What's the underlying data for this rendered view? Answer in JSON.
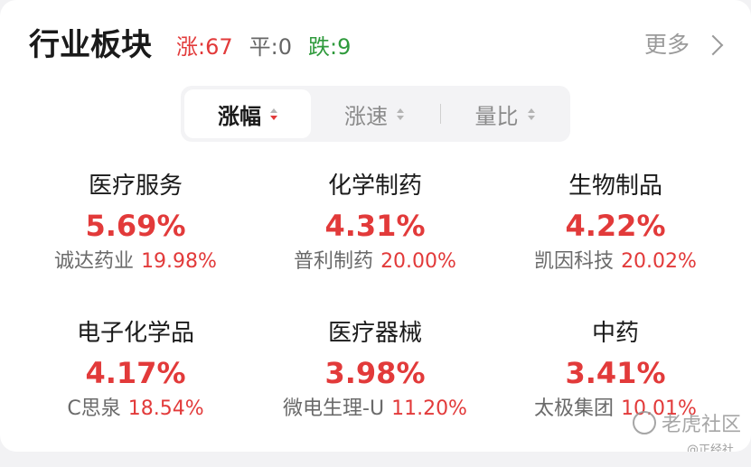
{
  "header": {
    "title": "行业板块",
    "stats": {
      "up": "涨:67",
      "flat": "平:0",
      "down": "跌:9"
    },
    "more_label": "更多"
  },
  "tabs": [
    {
      "label": "涨幅",
      "active": true
    },
    {
      "label": "涨速",
      "active": false
    },
    {
      "label": "量比",
      "active": false
    }
  ],
  "sectors": [
    {
      "name": "医疗服务",
      "pct": "5.69%",
      "stock": "诚达药业",
      "gain": "19.98%"
    },
    {
      "name": "化学制药",
      "pct": "4.31%",
      "stock": "普利制药",
      "gain": "20.00%"
    },
    {
      "name": "生物制品",
      "pct": "4.22%",
      "stock": "凯因科技",
      "gain": "20.02%"
    },
    {
      "name": "电子化学品",
      "pct": "4.17%",
      "stock": "C思泉",
      "gain": "18.54%"
    },
    {
      "name": "医疗器械",
      "pct": "3.98%",
      "stock": "微电生理-U",
      "gain": "11.20%"
    },
    {
      "name": "中药",
      "pct": "3.41%",
      "stock": "太极集团",
      "gain": "10.01%"
    }
  ],
  "watermark": {
    "brand": "老虎社区",
    "handle": "@正经社"
  },
  "colors": {
    "up": "#e23a3a",
    "down": "#2f9a3c",
    "neutral": "#666666"
  }
}
